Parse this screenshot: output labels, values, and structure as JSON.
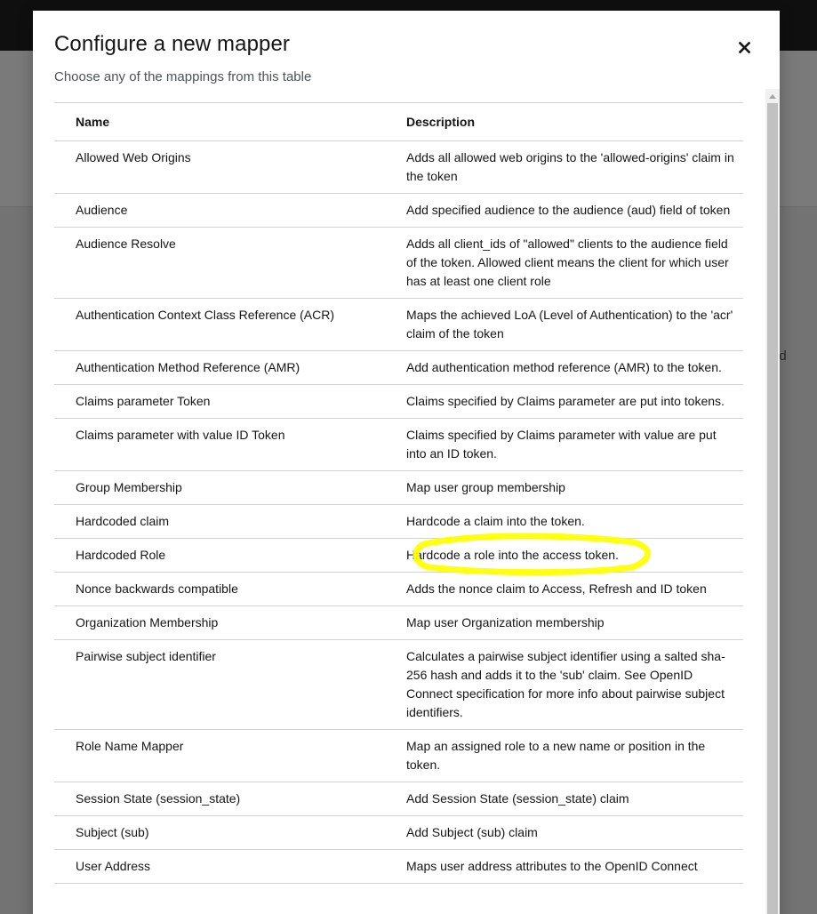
{
  "background": {
    "partial_text": "ed"
  },
  "modal": {
    "title": "Configure a new mapper",
    "subtitle": "Choose any of the mappings from this table",
    "close_icon": "close-icon"
  },
  "table": {
    "headers": {
      "name": "Name",
      "description": "Description"
    },
    "rows": [
      {
        "name": "Allowed Web Origins",
        "description": "Adds all allowed web origins to the 'allowed-origins' claim in the token"
      },
      {
        "name": "Audience",
        "description": "Add specified audience to the audience (aud) field of token"
      },
      {
        "name": "Audience Resolve",
        "description": "Adds all client_ids of \"allowed\" clients to the audience field of the token. Allowed client means the client for which user has at least one client role"
      },
      {
        "name": "Authentication Context Class Reference (ACR)",
        "description": "Maps the achieved LoA (Level of Authentication) to the 'acr' claim of the token"
      },
      {
        "name": "Authentication Method Reference (AMR)",
        "description": "Add authentication method reference (AMR) to the token."
      },
      {
        "name": "Claims parameter Token",
        "description": "Claims specified by Claims parameter are put into tokens."
      },
      {
        "name": "Claims parameter with value ID Token",
        "description": "Claims specified by Claims parameter with value are put into an ID token."
      },
      {
        "name": "Group Membership",
        "description": "Map user group membership"
      },
      {
        "name": "Hardcoded claim",
        "description": "Hardcode a claim into the token."
      },
      {
        "name": "Hardcoded Role",
        "description": "Hardcode a role into the access token."
      },
      {
        "name": "Nonce backwards compatible",
        "description": "Adds the nonce claim to Access, Refresh and ID token"
      },
      {
        "name": "Organization Membership",
        "description": "Map user Organization membership"
      },
      {
        "name": "Pairwise subject identifier",
        "description": "Calculates a pairwise subject identifier using a salted sha-256 hash and adds it to the 'sub' claim. See OpenID Connect specification for more info about pairwise subject identifiers."
      },
      {
        "name": "Role Name Mapper",
        "description": "Map an assigned role to a new name or position in the token."
      },
      {
        "name": "Session State (session_state)",
        "description": "Add Session State (session_state) claim"
      },
      {
        "name": "Subject (sub)",
        "description": "Add Subject (sub) claim"
      },
      {
        "name": "User Address",
        "description": "Maps user address attributes to the OpenID Connect"
      }
    ]
  },
  "colors": {
    "highlight": "#ffff00",
    "border": "#d2d2d2",
    "text": "#151515"
  }
}
